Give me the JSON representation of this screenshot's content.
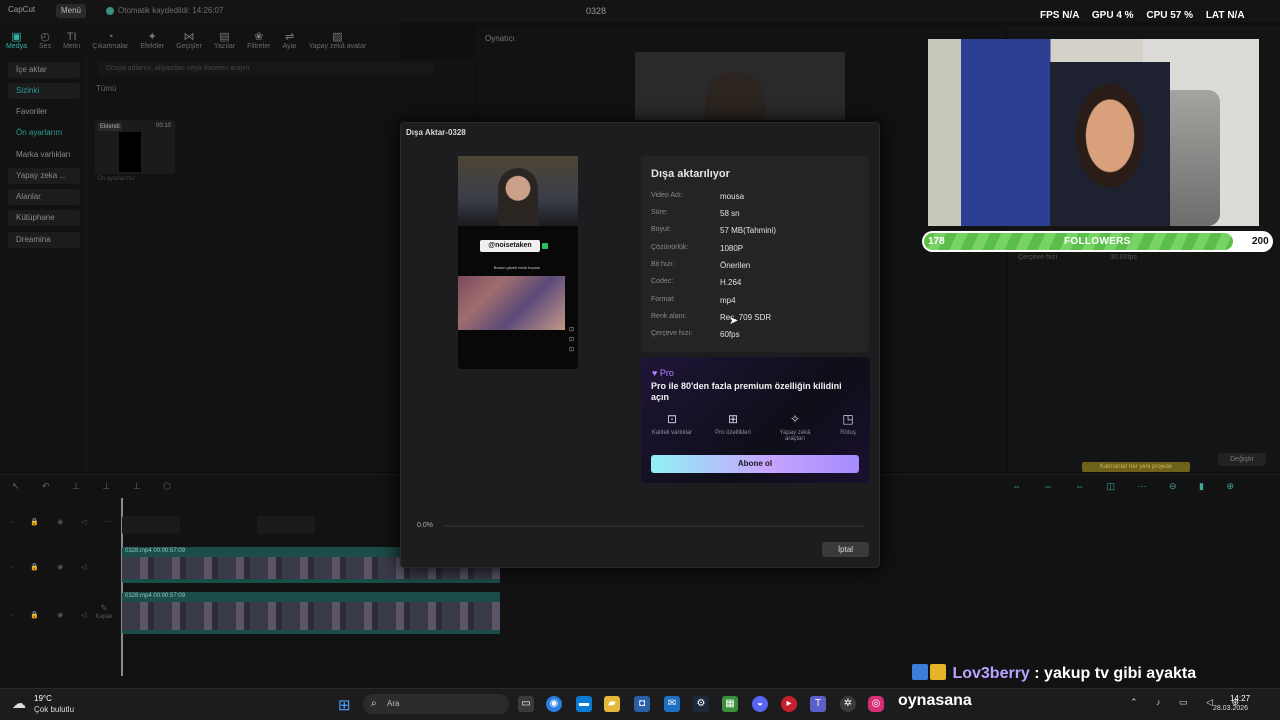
{
  "app": {
    "logo": "CapCut",
    "menu": "Menü",
    "autosave": "Otomatik kaydedildi: 14:26:07",
    "project_title": "0328"
  },
  "toolbar": [
    "Medya",
    "Ses",
    "Metin",
    "Çıkartmalar",
    "Efektler",
    "Geçişler",
    "Yazılar",
    "Filtreler",
    "Ayar",
    "Yapay zekâ avatar"
  ],
  "toolbar_icons": [
    "media-icon",
    "audio-icon",
    "text-icon",
    "sticker-icon",
    "effects-icon",
    "transitions-icon",
    "captions-icon",
    "filters-icon",
    "adjust-icon",
    "ai-avatar-icon"
  ],
  "sidebar": [
    {
      "label": "İçe aktar"
    },
    {
      "label": "Sizinki"
    },
    {
      "label": "Favoriler"
    },
    {
      "label": "Ön ayarlarım"
    },
    {
      "label": "Marka varlıkları"
    },
    {
      "label": "Yapay zeka ..."
    },
    {
      "label": "Alanlar"
    },
    {
      "label": "Kütüphane"
    },
    {
      "label": "Dreamina"
    }
  ],
  "media": {
    "search_placeholder": "Dosya adlarını, altyazıları veya ifadeleri arayın",
    "all": "Tümü",
    "thumb_badge": "Eklendi",
    "thumb_duration": "00:10",
    "thumb_name": "Ön ayarlarım2"
  },
  "player": {
    "label": "Oynatıcı"
  },
  "right_panel": {
    "fps_label": "Çerçeve hızı",
    "fps_value": "30.00fps",
    "change": "Değiştir",
    "tip": "Katmanlar her yeni projede"
  },
  "timeline": {
    "clip1_name": "0328.mp4  00:00:57:09",
    "clip2_name": "0328.mp4  00:00:57:09",
    "cover": "Kapak"
  },
  "dialog": {
    "title": "Dışa Aktar-0328",
    "preview_tag": "@noisetaken",
    "preview_caption": "Bunun güzeli nedir hocam",
    "info_title": "Dışa aktarılıyor",
    "rows": [
      {
        "k": "Video Adı:",
        "v": "mousa"
      },
      {
        "k": "Süre:",
        "v": "58 sn"
      },
      {
        "k": "Boyut:",
        "v": "57 MB(Tahmini)"
      },
      {
        "k": "Çözünürlük:",
        "v": "1080P"
      },
      {
        "k": "Bit hızı:",
        "v": "Önerilen"
      },
      {
        "k": "Codec:",
        "v": "H.264"
      },
      {
        "k": "Format:",
        "v": "mp4"
      },
      {
        "k": "Renk alanı:",
        "v": "Rec. 709 SDR"
      },
      {
        "k": "Çerçeve hızı:",
        "v": "60fps"
      }
    ],
    "pro_badge": "Pro",
    "pro_title": "Pro ile 80'den fazla premium özelliğin kilidini açın",
    "pro_features": [
      {
        "label": "Kaliteli varlıklar",
        "icon": "image-icon"
      },
      {
        "label": "Pro özellikleri",
        "icon": "grid-icon"
      },
      {
        "label": "Yapay zekâ araçları",
        "icon": "magic-wand-icon"
      },
      {
        "label": "Rötuş",
        "icon": "retouch-icon"
      }
    ],
    "subscribe": "Abone ol",
    "progress_text": "0.0%",
    "progress": 0.0,
    "cancel": "İptal"
  },
  "overlay": {
    "fps_k": "FPS",
    "fps_v": "N/A",
    "gpu_k": "GPU",
    "gpu_v": "4 %",
    "cpu_k": "CPU",
    "cpu_v": "57 %",
    "lat_k": "LAT",
    "lat_v": "N/A",
    "followers_current": "178",
    "followers_label": "FOLLOWERS",
    "followers_goal": "200",
    "followers_fraction": 0.89,
    "chat_user": "Lov3berry",
    "chat_msg": ": yakup tv gibi ayakta",
    "bottom_text": "oynasana"
  },
  "taskbar": {
    "temp": "19°C",
    "weather": "Çok bulutlu",
    "search_placeholder": "Ara",
    "time": "14:27",
    "date": "28.03.2026"
  },
  "colors": {
    "accent": "#2fb3a7",
    "pro": "#b483ff",
    "followers": "#5cbe4a"
  }
}
